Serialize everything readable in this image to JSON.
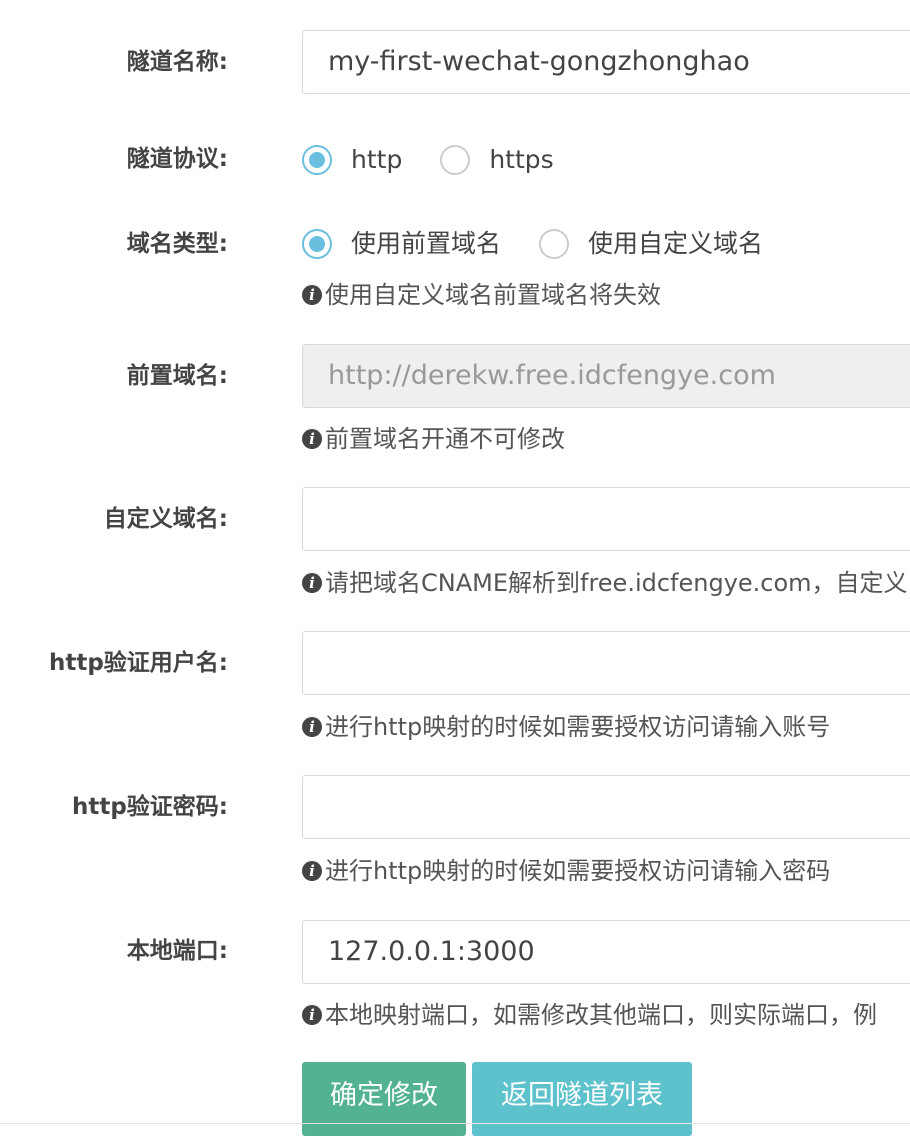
{
  "tunnel_name": {
    "label": "隧道名称:",
    "value": "my-first-wechat-gongzhonghao"
  },
  "protocol": {
    "label": "隧道协议:",
    "options": [
      {
        "label": "http",
        "checked": true
      },
      {
        "label": "https",
        "checked": false
      }
    ]
  },
  "domain_type": {
    "label": "域名类型:",
    "options": [
      {
        "label": "使用前置域名",
        "checked": true
      },
      {
        "label": "使用自定义域名",
        "checked": false
      }
    ],
    "help": "使用自定义域名前置域名将失效"
  },
  "prefix_domain": {
    "label": "前置域名:",
    "value": "http://derekw.free.idcfengye.com",
    "help": "前置域名开通不可修改"
  },
  "custom_domain": {
    "label": "自定义域名:",
    "value": "",
    "help": "请把域名CNAME解析到free.idcfengye.com，自定义"
  },
  "http_auth_user": {
    "label": "http验证用户名:",
    "value": "",
    "help": "进行http映射的时候如需要授权访问请输入账号"
  },
  "http_auth_password": {
    "label": "http验证密码:",
    "value": "",
    "help": "进行http映射的时候如需要授权访问请输入密码"
  },
  "local_port": {
    "label": "本地端口:",
    "value": "127.0.0.1:3000",
    "help": "本地映射端口，如需修改其他端口，则实际端口，例"
  },
  "buttons": {
    "confirm": "确定修改",
    "back": "返回隧道列表"
  },
  "icons": {
    "info": "info-circle-icon"
  },
  "colors": {
    "radio_checked": "#6bbfde",
    "primary_button": "#53b391",
    "info_button": "#5dc2cc"
  }
}
